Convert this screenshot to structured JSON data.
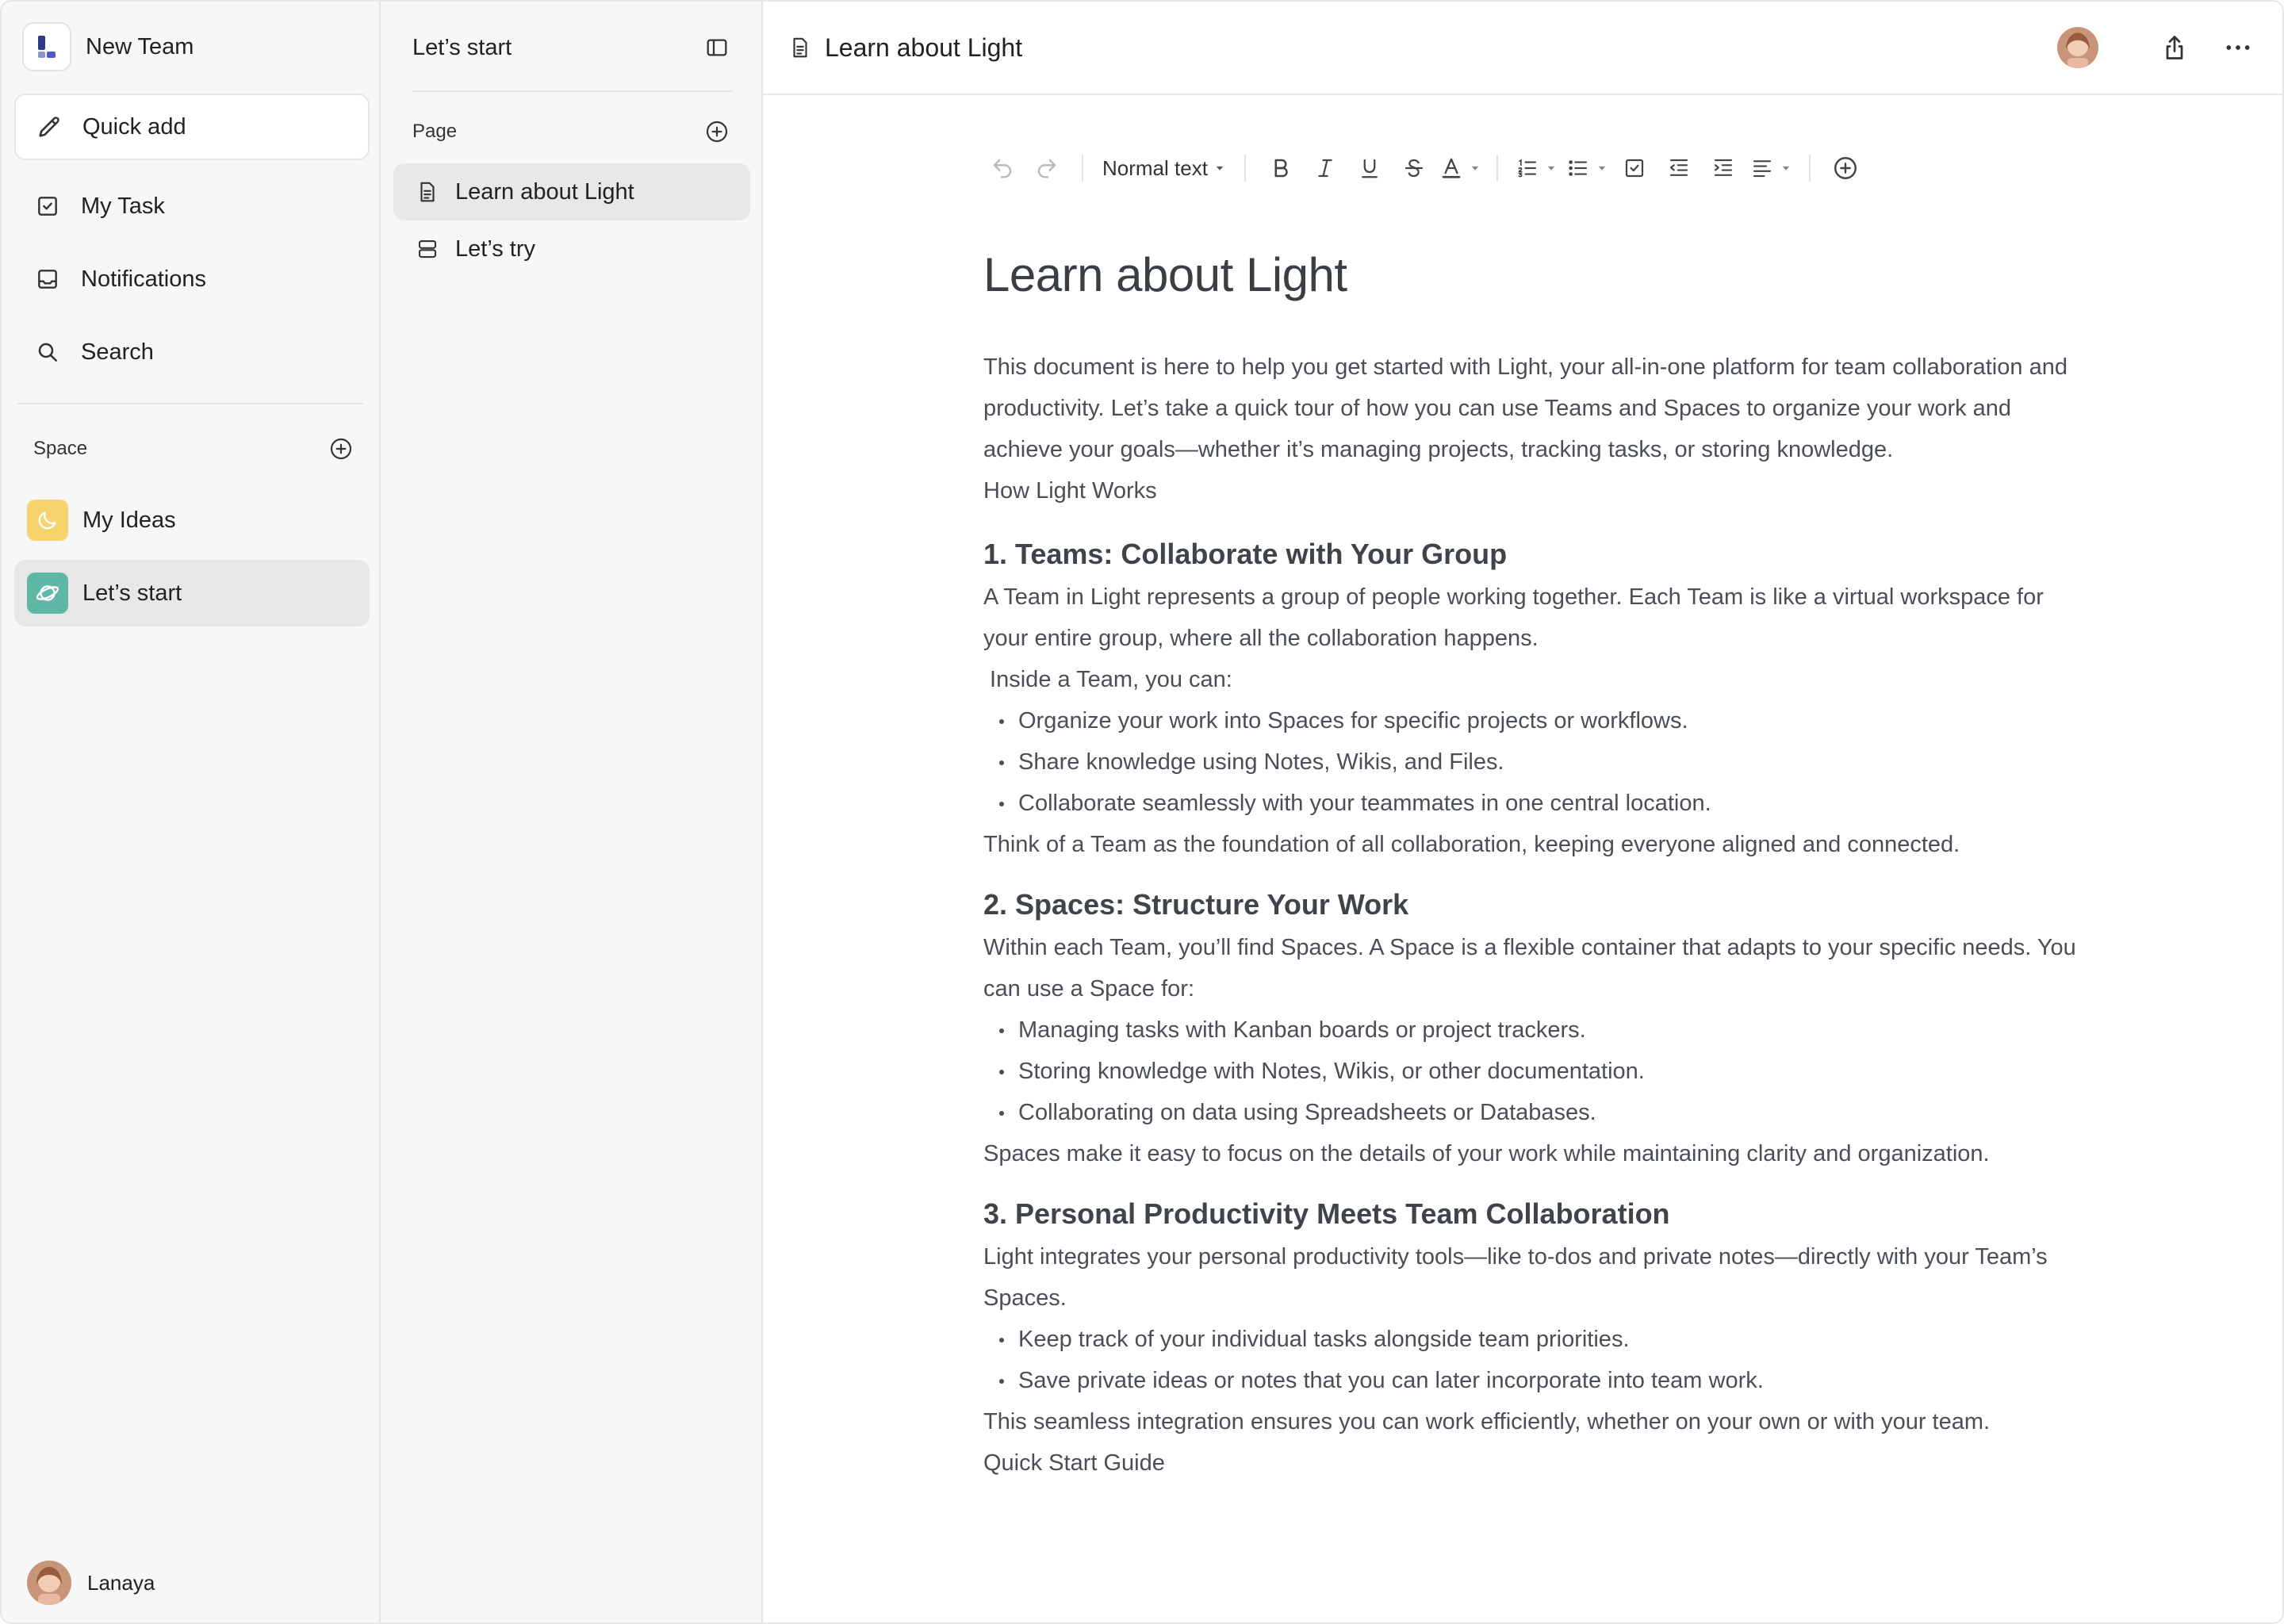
{
  "sidebar": {
    "team_name": "New Team",
    "quick_add": "Quick add",
    "nav": [
      {
        "label": "My Task",
        "icon": "checkbox-icon"
      },
      {
        "label": "Notifications",
        "icon": "inbox-icon"
      },
      {
        "label": "Search",
        "icon": "search-icon"
      }
    ],
    "space_title": "Space",
    "spaces": [
      {
        "label": "My Ideas",
        "icon": "moon-icon",
        "color": "#f7d36e",
        "active": false
      },
      {
        "label": "Let’s start",
        "icon": "planet-icon",
        "color": "#5fb7a8",
        "active": true
      }
    ],
    "user_name": "Lanaya"
  },
  "pages": {
    "title": "Let’s start",
    "section_title": "Page",
    "items": [
      {
        "label": "Learn about Light",
        "icon": "document-icon",
        "active": true
      },
      {
        "label": "Let’s try",
        "icon": "database-icon",
        "active": false
      }
    ]
  },
  "topbar": {
    "doc_title": "Learn about Light"
  },
  "toolbar": {
    "text_style": "Normal text"
  },
  "document": {
    "title": "Learn about Light",
    "intro": "This document is here to help you get started with Light, your all-in-one platform for team collaboration and productivity. Let’s take a quick tour of how you can use Teams and Spaces to organize your work and achieve your goals—whether it’s managing projects, tracking tasks, or storing knowledge.",
    "how_it_works": "How Light Works",
    "section1": {
      "heading": "1. Teams: Collaborate with Your Group",
      "para": "A Team in Light represents a group of people working together. Each Team is like a virtual workspace for your entire group, where all the collaboration happens.",
      "lead": " Inside a Team, you can:",
      "bullets": [
        "Organize your work into Spaces for specific projects or workflows.",
        "Share knowledge using Notes, Wikis, and Files.",
        "Collaborate seamlessly with your teammates in one central location."
      ],
      "closing": "Think of a Team as the foundation of all collaboration, keeping everyone aligned and connected."
    },
    "section2": {
      "heading": "2. Spaces: Structure Your Work",
      "para": "Within each Team, you’ll find Spaces. A Space is a flexible container that adapts to your specific needs. You can use a Space for:",
      "bullets": [
        "Managing tasks with Kanban boards or project trackers.",
        "Storing knowledge with Notes, Wikis, or other documentation.",
        "Collaborating on data using Spreadsheets or Databases."
      ],
      "closing": "Spaces make it easy to focus on the details of your work while maintaining clarity and organization."
    },
    "section3": {
      "heading": "3. Personal Productivity Meets Team Collaboration",
      "para": "Light integrates your personal productivity tools—like to-dos and private notes—directly with your Team’s Spaces.",
      "bullets": [
        "Keep track of your individual tasks alongside team priorities.",
        "Save private ideas or notes that you can later incorporate into team work."
      ],
      "closing": "This seamless integration ensures you can work efficiently, whether on your own or with your team."
    },
    "next_heading": "Quick Start Guide"
  }
}
